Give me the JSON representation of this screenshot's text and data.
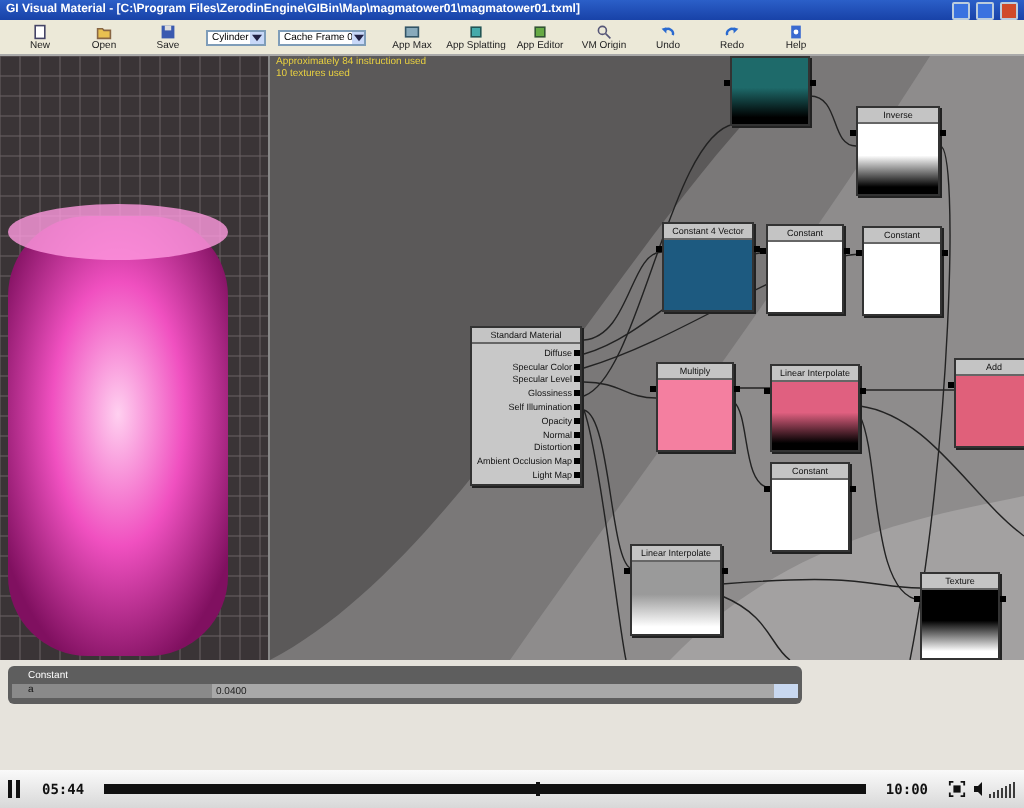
{
  "window": {
    "title": "GI Visual Material - [C:\\Program Files\\ZerodinEngine\\GIBin\\Map\\magmatower01\\magmatower01.txml]"
  },
  "toolbar": {
    "buttons": [
      {
        "label": "New"
      },
      {
        "label": "Open"
      },
      {
        "label": "Save"
      }
    ],
    "dropdowns": [
      {
        "value": "Cylinder"
      },
      {
        "value": "Cache Frame 0"
      }
    ],
    "tools": [
      {
        "label": "App Max"
      },
      {
        "label": "App Splatting"
      },
      {
        "label": "App Editor"
      },
      {
        "label": "VM Origin"
      },
      {
        "label": "Undo"
      },
      {
        "label": "Redo"
      },
      {
        "label": "Help"
      }
    ]
  },
  "canvas": {
    "stats": [
      "Approximately 84 instruction used",
      "10 textures used"
    ],
    "nodes": [
      {
        "kind": "fade-to-dark",
        "color": "#1e6a6a"
      },
      {
        "title": "Inverse",
        "kind": "fade-to-dark",
        "color": "#ffffff"
      },
      {
        "title": "Constant 4 Vector",
        "kind": "swatch",
        "color": "#1d5a80"
      },
      {
        "title": "Constant",
        "kind": "swatch",
        "color": "#ffffff"
      },
      {
        "title": "Constant",
        "kind": "swatch",
        "color": "#ffffff"
      },
      {
        "title": "Standard Material",
        "kind": "material",
        "ports": [
          "Diffuse",
          "Specular Color",
          "Specular Level",
          "Glossiness",
          "Self Illumination",
          "Opacity",
          "Normal",
          "Distortion",
          "Ambient Occlusion Map",
          "Light Map"
        ]
      },
      {
        "title": "Multiply",
        "kind": "swatch",
        "color": "#f47fa0"
      },
      {
        "title": "Linear Interpolate",
        "kind": "fade-to-dark",
        "color": "#e06080"
      },
      {
        "title": "Add",
        "kind": "swatch",
        "color": "#e0607a"
      },
      {
        "title": "Constant",
        "kind": "swatch",
        "color": "#ffffff"
      },
      {
        "title": "Linear Interpolate",
        "kind": "fade-to-light",
        "color": "#9a9a9a"
      },
      {
        "title": "Texture",
        "kind": "fade-to-light",
        "color": "#000000"
      }
    ]
  },
  "properties": {
    "title": "Constant",
    "rows": [
      {
        "label": "a",
        "value": "0.0400"
      }
    ]
  },
  "player": {
    "playing": true,
    "current": "05:44",
    "level": 0.57,
    "total": "10:00"
  }
}
